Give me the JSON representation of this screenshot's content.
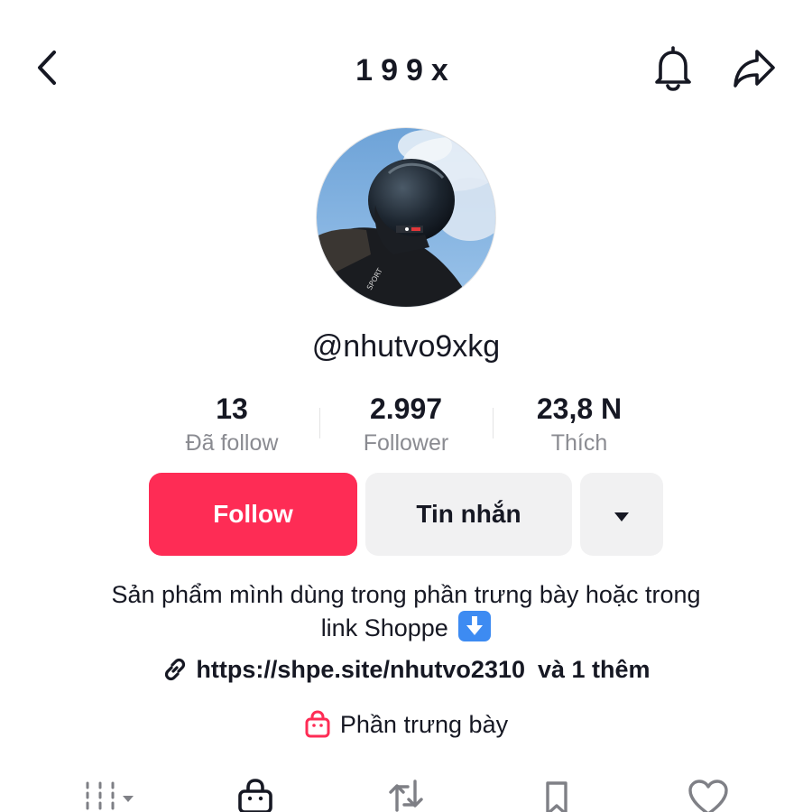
{
  "header": {
    "title": "199x",
    "back_icon": "chevron-left-icon",
    "bell_icon": "bell-icon",
    "share_icon": "share-arrow-icon"
  },
  "profile": {
    "username": "@nhutvo9xkg",
    "avatar": "avatar-helmet-rider"
  },
  "stats": [
    {
      "value": "13",
      "label": "Đã follow"
    },
    {
      "value": "2.997",
      "label": "Follower"
    },
    {
      "value": "23,8 N",
      "label": "Thích"
    }
  ],
  "actions": {
    "follow_label": "Follow",
    "message_label": "Tin nhắn",
    "more_icon": "caret-down-icon"
  },
  "bio": {
    "line1": "Sản phẩm mình dùng trong phần trưng bày hoặc trong",
    "line2": "link Shoppe",
    "emoji": "down-arrow-emoji",
    "link_text": "https://shpe.site/nhutvo2310",
    "link_more": "và 1 thêm",
    "showcase_label": "Phần trưng bày"
  },
  "tabs": [
    {
      "name": "videos",
      "icon": "grid-icon"
    },
    {
      "name": "shop",
      "icon": "shopping-bag-icon"
    },
    {
      "name": "reposts",
      "icon": "repost-icon"
    },
    {
      "name": "saved",
      "icon": "bookmark-icon"
    },
    {
      "name": "liked",
      "icon": "heart-icon"
    }
  ],
  "colors": {
    "accent": "#fe2c55",
    "text": "#161823",
    "muted": "#8a8b91",
    "button_bg": "#f1f1f2"
  }
}
